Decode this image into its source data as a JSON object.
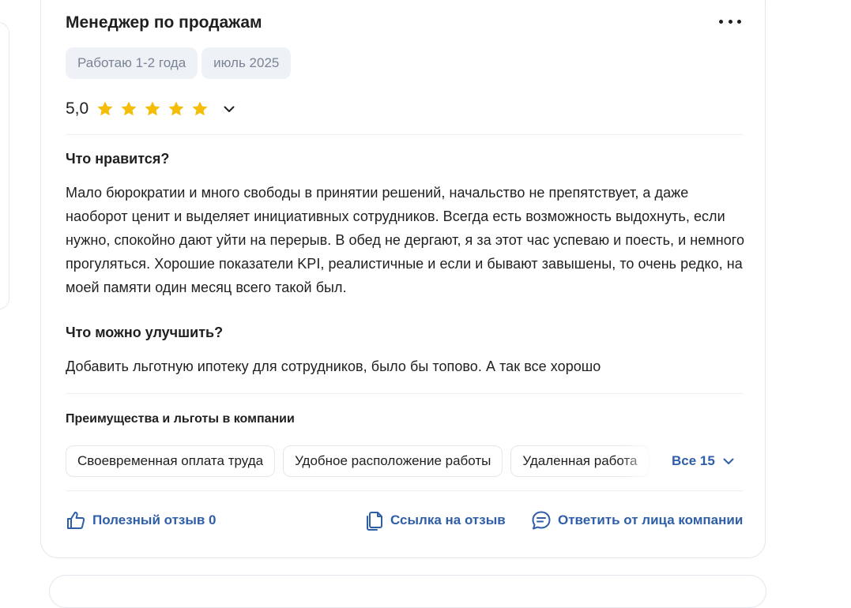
{
  "review": {
    "title": "Менеджер по продажам",
    "tags": [
      "Работаю 1-2 года",
      "июль 2025"
    ],
    "rating": {
      "value": "5,0",
      "stars": 5
    },
    "likes_heading": "Что нравится?",
    "likes_text": "Мало бюрократии и много свободы в принятии решений, начальство не препятствует, а даже наоборот ценит и выделяет инициативных сотрудников. Всегда есть возможность выдохнуть, если нужно, спокойно дают уйти на перерыв. В обед не дергают, я за этот час успеваю и поесть, и немного прогуляться. Хорошие показатели KPI, реалистичные и если и бывают завышены, то очень редко, на моей памяти один месяц всего такой был.",
    "improve_heading": "Что можно улучшить?",
    "improve_text": "Добавить льготную ипотеку для сотрудников, было бы топово. А так все хорошо"
  },
  "benefits": {
    "title": "Преимущества и льготы в компании",
    "chips": [
      "Своевременная оплата труда",
      "Удобное расположение работы",
      "Удаленная работа"
    ],
    "all_label": "Все 15"
  },
  "actions": {
    "helpful_label": "Полезный отзыв 0",
    "link_label": "Ссылка на отзыв",
    "reply_label": "Ответить от лица компании"
  },
  "colors": {
    "accent": "#2f5ea8",
    "star": "#f5bd07",
    "tag_bg": "#eef1f6",
    "tag_text": "#7b8494"
  },
  "icons": [
    "more-icon",
    "star-icon",
    "chevron-down-icon",
    "thumbs-up-icon",
    "copy-link-icon",
    "chat-bubble-icon"
  ]
}
